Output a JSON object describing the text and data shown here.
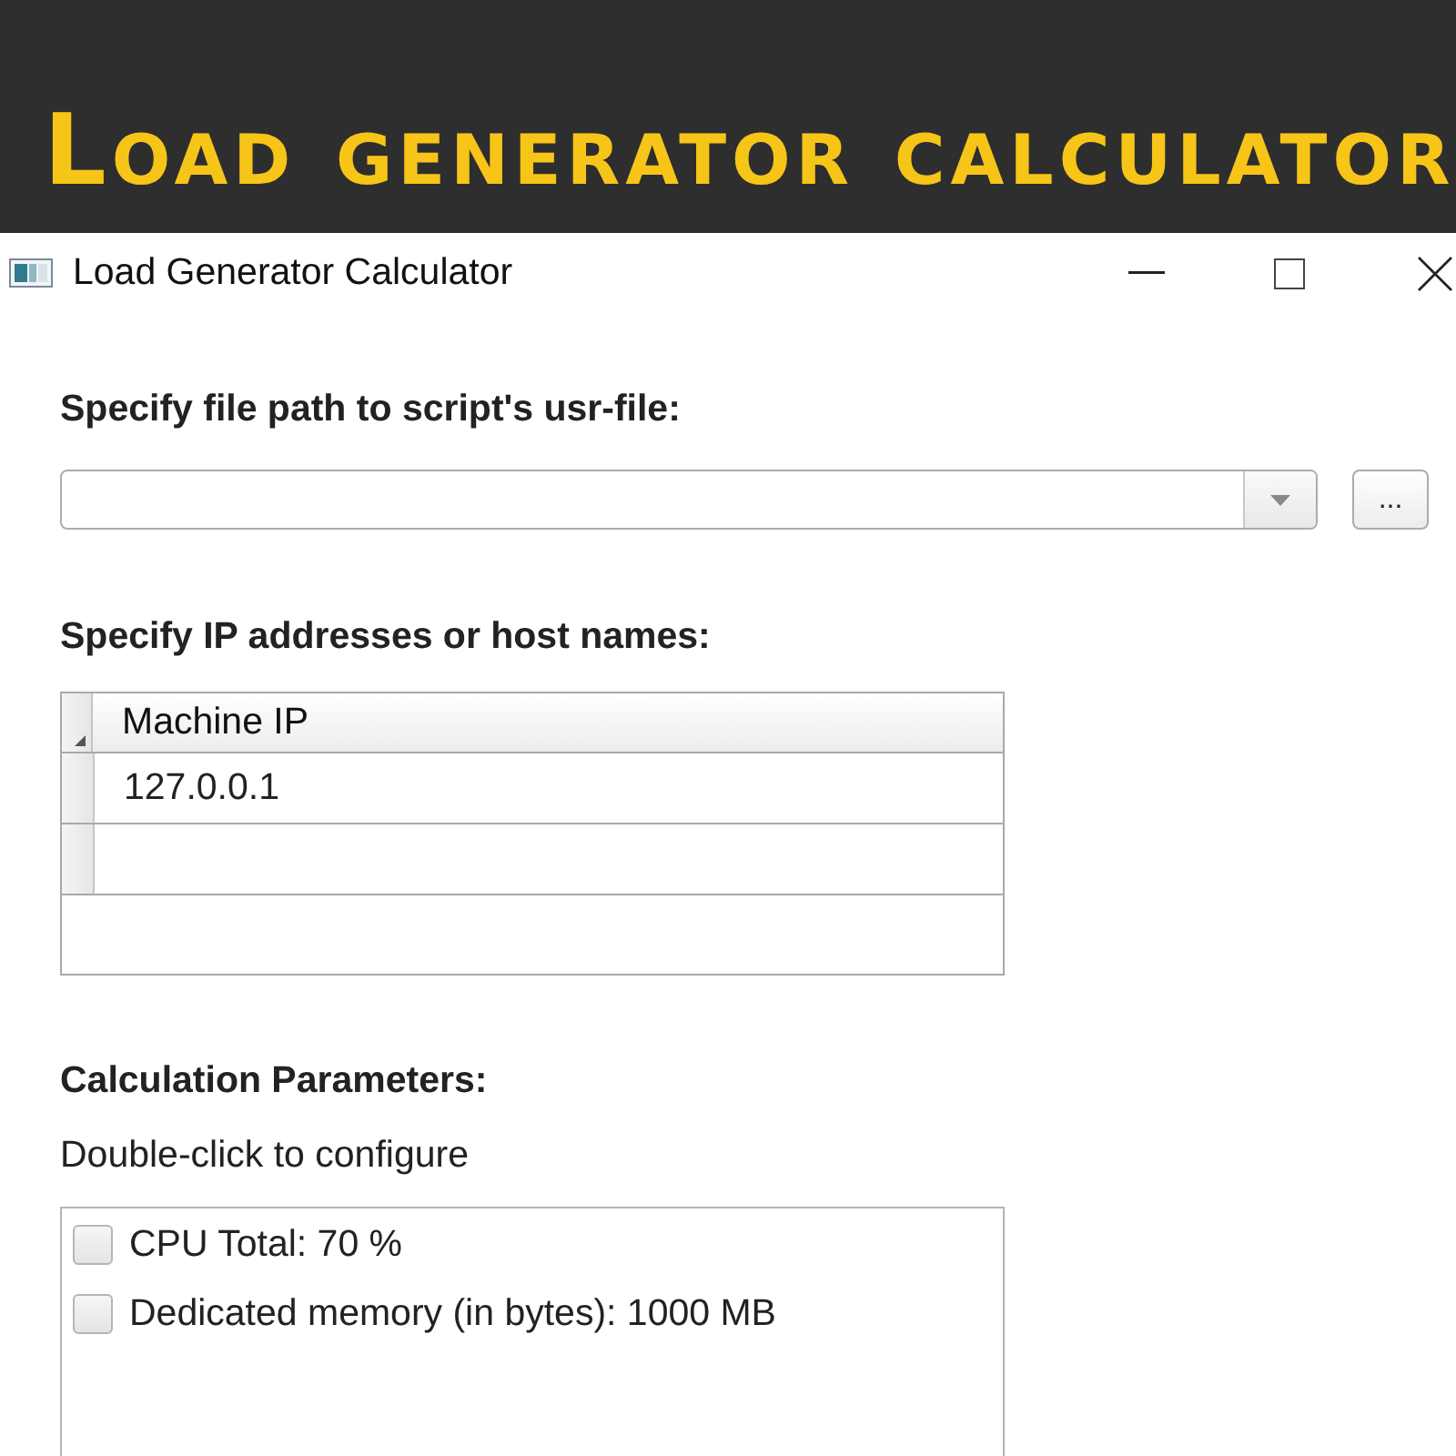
{
  "banner": {
    "title": "Load generator calculator"
  },
  "window": {
    "title": "Load Generator Calculator"
  },
  "file_path": {
    "label": "Specify file path to script's usr-file:",
    "browse_button": "..."
  },
  "hosts": {
    "label": "Specify IP addresses or host names:",
    "columns": [
      "Machine IP"
    ],
    "rows": [
      [
        "127.0.0.1"
      ]
    ]
  },
  "parameters": {
    "label": "Calculation Parameters:",
    "hint": "Double-click to configure",
    "items": [
      {
        "label": "CPU Total: 70 %",
        "checked": false
      },
      {
        "label": "Dedicated memory (in bytes): 1000 MB",
        "checked": false
      }
    ]
  }
}
